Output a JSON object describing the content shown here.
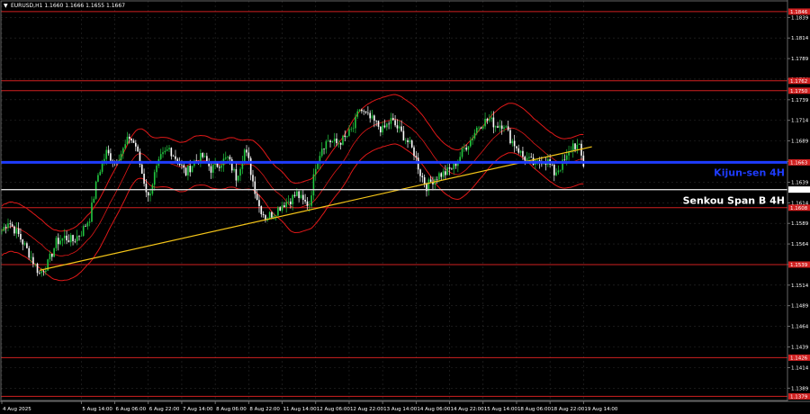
{
  "header": {
    "symbol_line": "EURUSD,H1  1.1660 1.1666 1.1655 1.1667"
  },
  "colors": {
    "background": "#000000",
    "grid": "#2b2b2b",
    "candle_bull": "#22c840",
    "candle_bear": "#ffffff",
    "ichimoku": "#e01818",
    "trendline": "#f5c518",
    "kijun": "#1e3cff",
    "senkou": "#d8d8d8",
    "level": "#d02020"
  },
  "chart_data": {
    "type": "candlestick",
    "symbol": "EURUSD",
    "timeframe": "H1",
    "ylim": [
      1.1374,
      1.1859
    ],
    "y_ticks": [
      1.1839,
      1.1814,
      1.1789,
      1.1764,
      1.1739,
      1.1714,
      1.1689,
      1.1664,
      1.1639,
      1.1614,
      1.1589,
      1.1564,
      1.1539,
      1.1514,
      1.1489,
      1.1464,
      1.1439,
      1.1414,
      1.1389
    ],
    "x_ticks": [
      {
        "label": "4 Aug 2025",
        "i": 0
      },
      {
        "label": "5 Aug 14:00",
        "i": 38
      },
      {
        "label": "6 Aug 06:00",
        "i": 54
      },
      {
        "label": "6 Aug 22:00",
        "i": 70
      },
      {
        "label": "7 Aug 14:00",
        "i": 86
      },
      {
        "label": "8 Aug 06:00",
        "i": 102
      },
      {
        "label": "8 Aug 22:00",
        "i": 118
      },
      {
        "label": "11 Aug 14:00",
        "i": 134
      },
      {
        "label": "12 Aug 06:00",
        "i": 150
      },
      {
        "label": "12 Aug 22:00",
        "i": 166
      },
      {
        "label": "13 Aug 14:00",
        "i": 182
      },
      {
        "label": "14 Aug 06:00",
        "i": 198
      },
      {
        "label": "14 Aug 22:00",
        "i": 214
      },
      {
        "label": "15 Aug 14:00",
        "i": 230
      },
      {
        "label": "18 Aug 06:00",
        "i": 246
      },
      {
        "label": "18 Aug 22:00",
        "i": 262
      },
      {
        "label": "19 Aug 14:00",
        "i": 278
      }
    ],
    "candle_count": 279,
    "close_anchors": [
      [
        0,
        1.158
      ],
      [
        3,
        1.1592
      ],
      [
        8,
        1.1575
      ],
      [
        14,
        1.1548
      ],
      [
        18,
        1.1528
      ],
      [
        22,
        1.154
      ],
      [
        26,
        1.1566
      ],
      [
        30,
        1.1572
      ],
      [
        34,
        1.1568
      ],
      [
        38,
        1.1578
      ],
      [
        42,
        1.1596
      ],
      [
        46,
        1.1648
      ],
      [
        50,
        1.1675
      ],
      [
        54,
        1.1664
      ],
      [
        58,
        1.1678
      ],
      [
        61,
        1.1694
      ],
      [
        64,
        1.1683
      ],
      [
        67,
        1.165
      ],
      [
        70,
        1.162
      ],
      [
        73,
        1.1648
      ],
      [
        76,
        1.1668
      ],
      [
        80,
        1.168
      ],
      [
        84,
        1.1665
      ],
      [
        88,
        1.165
      ],
      [
        92,
        1.1664
      ],
      [
        96,
        1.167
      ],
      [
        100,
        1.1655
      ],
      [
        104,
        1.1662
      ],
      [
        108,
        1.1668
      ],
      [
        112,
        1.1645
      ],
      [
        114,
        1.166
      ],
      [
        116,
        1.1678
      ],
      [
        118,
        1.1664
      ],
      [
        120,
        1.164
      ],
      [
        123,
        1.161
      ],
      [
        126,
        1.1596
      ],
      [
        130,
        1.1602
      ],
      [
        134,
        1.1612
      ],
      [
        138,
        1.1618
      ],
      [
        141,
        1.1625
      ],
      [
        144,
        1.1615
      ],
      [
        147,
        1.1612
      ],
      [
        150,
        1.166
      ],
      [
        153,
        1.1682
      ],
      [
        156,
        1.169
      ],
      [
        160,
        1.1686
      ],
      [
        164,
        1.1692
      ],
      [
        168,
        1.1705
      ],
      [
        171,
        1.1728
      ],
      [
        174,
        1.172
      ],
      [
        178,
        1.1712
      ],
      [
        182,
        1.1702
      ],
      [
        186,
        1.1714
      ],
      [
        190,
        1.1702
      ],
      [
        194,
        1.1688
      ],
      [
        197,
        1.1675
      ],
      [
        200,
        1.165
      ],
      [
        203,
        1.1634
      ],
      [
        206,
        1.1642
      ],
      [
        209,
        1.1648
      ],
      [
        212,
        1.165
      ],
      [
        215,
        1.1656
      ],
      [
        218,
        1.1666
      ],
      [
        221,
        1.168
      ],
      [
        224,
        1.169
      ],
      [
        227,
        1.1705
      ],
      [
        230,
        1.1712
      ],
      [
        233,
        1.1715
      ],
      [
        236,
        1.1708
      ],
      [
        240,
        1.171
      ],
      [
        243,
        1.1692
      ],
      [
        246,
        1.1682
      ],
      [
        249,
        1.167
      ],
      [
        252,
        1.1665
      ],
      [
        255,
        1.166
      ],
      [
        258,
        1.1666
      ],
      [
        261,
        1.1664
      ],
      [
        264,
        1.165
      ],
      [
        267,
        1.1658
      ],
      [
        270,
        1.1668
      ],
      [
        273,
        1.1685
      ],
      [
        276,
        1.168
      ],
      [
        278,
        1.166
      ]
    ],
    "level_lines": [
      {
        "price": 1.1846,
        "tag": "1.1846"
      },
      {
        "price": 1.1762,
        "tag": "1.1762"
      },
      {
        "price": 1.175,
        "tag": "1.1750"
      },
      {
        "price": 1.1608,
        "tag": "1.1608"
      },
      {
        "price": 1.1539,
        "tag": "1.1539"
      },
      {
        "price": 1.1426,
        "tag": "1.1426"
      },
      {
        "price": 1.1379,
        "tag": "1.1379"
      }
    ],
    "kijun_sen_4h": {
      "price": 1.1663,
      "label": "Kijun-sen 4H",
      "tag": "1.1663"
    },
    "senkou_span_b_4h": {
      "price": 1.163,
      "label": "Senkou Span B 4H",
      "tag": "1.1630"
    },
    "trendline": {
      "from": [
        18,
        1.1532
      ],
      "to": [
        282,
        1.1682
      ]
    },
    "cloud_period": 20,
    "cloud_half_width": 0.003
  }
}
